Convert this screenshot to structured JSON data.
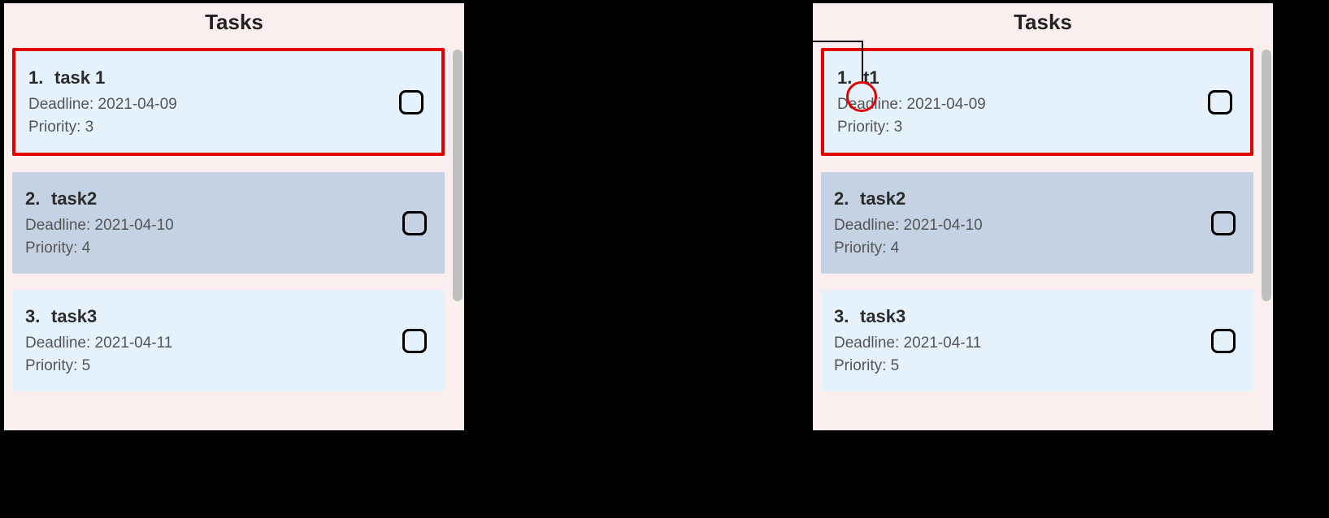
{
  "left": {
    "title": "Tasks",
    "tasks": [
      {
        "num": "1.",
        "title": "task 1",
        "deadline": "Deadline: 2021-04-09",
        "priority": "Priority: 3",
        "highlight": true,
        "shade": "light"
      },
      {
        "num": "2.",
        "title": "task2",
        "deadline": "Deadline: 2021-04-10",
        "priority": "Priority: 4",
        "highlight": false,
        "shade": "dark"
      },
      {
        "num": "3.",
        "title": "task3",
        "deadline": "Deadline: 2021-04-11",
        "priority": "Priority: 5",
        "highlight": false,
        "shade": "light"
      }
    ]
  },
  "right": {
    "title": "Tasks",
    "tasks": [
      {
        "num": "1.",
        "title": "t1",
        "deadline": "Deadline: 2021-04-09",
        "priority": "Priority: 3",
        "highlight": true,
        "shade": "light",
        "circled": true
      },
      {
        "num": "2.",
        "title": "task2",
        "deadline": "Deadline: 2021-04-10",
        "priority": "Priority: 4",
        "highlight": false,
        "shade": "dark"
      },
      {
        "num": "3.",
        "title": "task3",
        "deadline": "Deadline: 2021-04-11",
        "priority": "Priority: 5",
        "highlight": false,
        "shade": "light"
      }
    ]
  }
}
